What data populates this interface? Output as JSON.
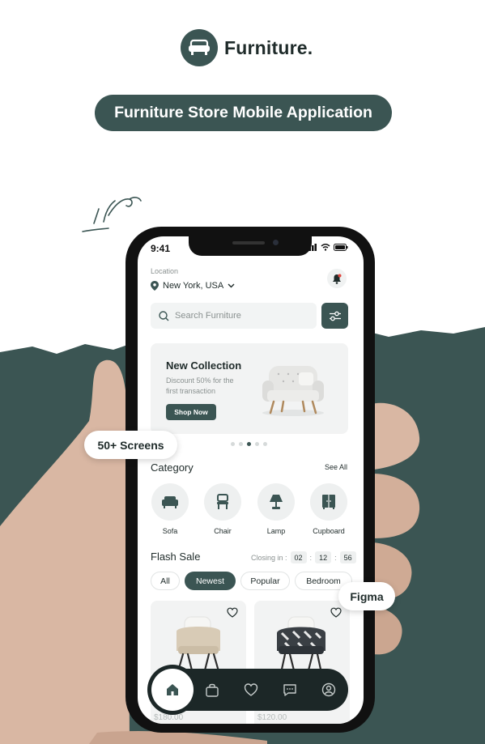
{
  "brand": {
    "name": "Furniture."
  },
  "hero": {
    "title": "Furniture Store Mobile Application"
  },
  "badges": {
    "screens": "50+ Screens",
    "figma": "Figma"
  },
  "colors": {
    "primary": "#3b5553",
    "dark": "#1c2727",
    "light": "#f2f3f3"
  },
  "app": {
    "status": {
      "time": "9:41"
    },
    "location": {
      "label": "Location",
      "value": "New York, USA"
    },
    "search": {
      "placeholder": "Search Furniture"
    },
    "banner": {
      "title": "New Collection",
      "subtitle": "Discount 50% for the first transaction",
      "button": "Shop Now",
      "slides": 5,
      "active_slide": 3
    },
    "category": {
      "title": "Category",
      "see_all": "See All",
      "items": [
        {
          "label": "Sofa",
          "icon": "sofa-icon"
        },
        {
          "label": "Chair",
          "icon": "chair-icon"
        },
        {
          "label": "Lamp",
          "icon": "lamp-icon"
        },
        {
          "label": "Cupboard",
          "icon": "cupboard-icon"
        }
      ]
    },
    "flash_sale": {
      "title": "Flash Sale",
      "closing_label": "Closing in :",
      "hours": "02",
      "minutes": "12",
      "seconds": "56",
      "filters": [
        "All",
        "Newest",
        "Popular",
        "Bedroom"
      ],
      "active_filter": "Newest",
      "products": [
        {
          "price": "$180.00"
        },
        {
          "price": "$120.00"
        }
      ]
    },
    "nav": [
      "home-icon",
      "bag-icon",
      "heart-icon",
      "chat-icon",
      "profile-icon"
    ]
  }
}
